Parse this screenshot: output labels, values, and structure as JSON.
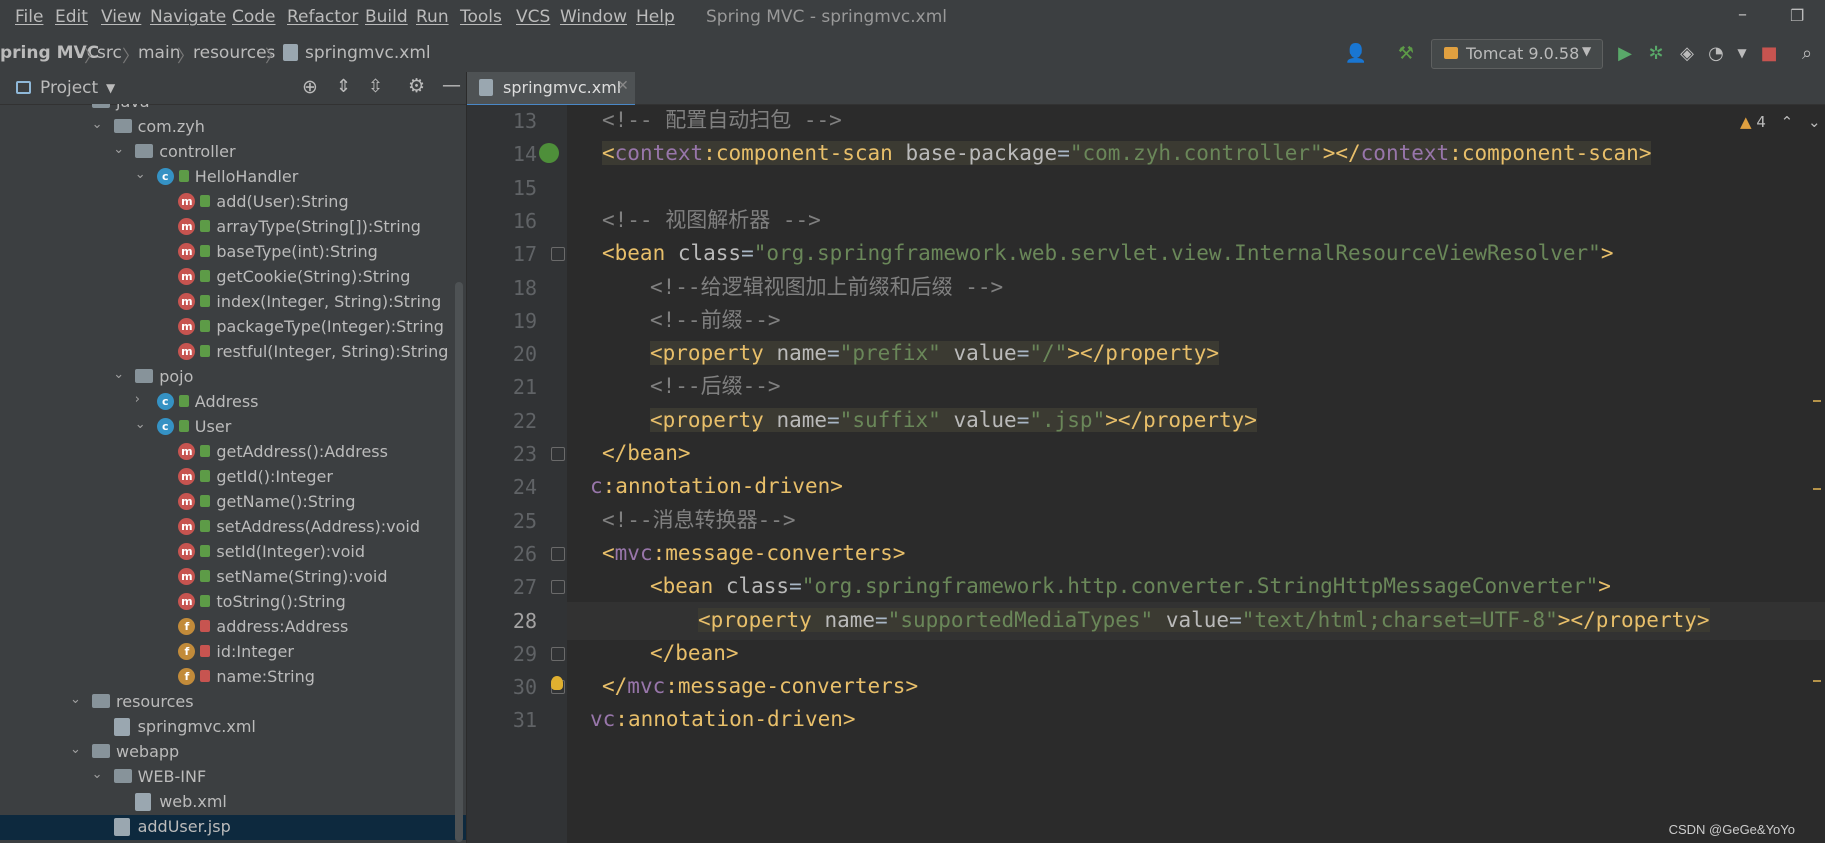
{
  "menu": [
    "File",
    "Edit",
    "View",
    "Navigate",
    "Code",
    "Refactor",
    "Build",
    "Run",
    "Tools",
    "VCS",
    "Window",
    "Help"
  ],
  "window_title": "Spring MVC - springmvc.xml",
  "breadcrumb": [
    "pring MVC",
    "src",
    "main",
    "resources",
    "springmvc.xml"
  ],
  "run_config": "Tomcat 9.0.58",
  "sidebar": {
    "title": "Project",
    "tree": [
      {
        "label": "java",
        "indent": 1,
        "arrow": "",
        "icon": "folder"
      },
      {
        "label": "com.zyh",
        "indent": 2,
        "arrow": "v",
        "icon": "folder"
      },
      {
        "label": "controller",
        "indent": 3,
        "arrow": "v",
        "icon": "folder"
      },
      {
        "label": "HelloHandler",
        "indent": 4,
        "arrow": "v",
        "icon": "c"
      },
      {
        "label": "add(User):String",
        "indent": 5,
        "arrow": "",
        "icon": "m"
      },
      {
        "label": "arrayType(String[]):String",
        "indent": 5,
        "arrow": "",
        "icon": "m"
      },
      {
        "label": "baseType(int):String",
        "indent": 5,
        "arrow": "",
        "icon": "m"
      },
      {
        "label": "getCookie(String):String",
        "indent": 5,
        "arrow": "",
        "icon": "m"
      },
      {
        "label": "index(Integer, String):String",
        "indent": 5,
        "arrow": "",
        "icon": "m"
      },
      {
        "label": "packageType(Integer):String",
        "indent": 5,
        "arrow": "",
        "icon": "m"
      },
      {
        "label": "restful(Integer, String):String",
        "indent": 5,
        "arrow": "",
        "icon": "m"
      },
      {
        "label": "pojo",
        "indent": 3,
        "arrow": "v",
        "icon": "folder"
      },
      {
        "label": "Address",
        "indent": 4,
        "arrow": ">",
        "icon": "c"
      },
      {
        "label": "User",
        "indent": 4,
        "arrow": "v",
        "icon": "c"
      },
      {
        "label": "getAddress():Address",
        "indent": 5,
        "arrow": "",
        "icon": "m"
      },
      {
        "label": "getId():Integer",
        "indent": 5,
        "arrow": "",
        "icon": "m"
      },
      {
        "label": "getName():String",
        "indent": 5,
        "arrow": "",
        "icon": "m"
      },
      {
        "label": "setAddress(Address):void",
        "indent": 5,
        "arrow": "",
        "icon": "m"
      },
      {
        "label": "setId(Integer):void",
        "indent": 5,
        "arrow": "",
        "icon": "m"
      },
      {
        "label": "setName(String):void",
        "indent": 5,
        "arrow": "",
        "icon": "m"
      },
      {
        "label": "toString():String",
        "indent": 5,
        "arrow": "",
        "icon": "m"
      },
      {
        "label": "address:Address",
        "indent": 5,
        "arrow": "",
        "icon": "f"
      },
      {
        "label": "id:Integer",
        "indent": 5,
        "arrow": "",
        "icon": "f"
      },
      {
        "label": "name:String",
        "indent": 5,
        "arrow": "",
        "icon": "f"
      },
      {
        "label": "resources",
        "indent": 1,
        "arrow": "v",
        "icon": "folder"
      },
      {
        "label": "springmvc.xml",
        "indent": 2,
        "arrow": "",
        "icon": "file"
      },
      {
        "label": "webapp",
        "indent": 1,
        "arrow": "v",
        "icon": "folder"
      },
      {
        "label": "WEB-INF",
        "indent": 2,
        "arrow": "v",
        "icon": "folder"
      },
      {
        "label": "web.xml",
        "indent": 3,
        "arrow": "",
        "icon": "file"
      },
      {
        "label": "addUser.jsp",
        "indent": 2,
        "arrow": "",
        "icon": "file",
        "selected": true
      }
    ]
  },
  "editor": {
    "tab": "springmvc.xml",
    "warnings": "4",
    "lines": [
      {
        "n": "13",
        "indent": 1,
        "parts": [
          [
            "com",
            "<!-- 配置自动扫包 -->"
          ]
        ]
      },
      {
        "n": "14",
        "indent": 1,
        "hl": true,
        "parts": [
          [
            "tag",
            "<"
          ],
          [
            "ns",
            "context"
          ],
          [
            "tag",
            ":component-scan "
          ],
          [
            "attr",
            "base-package"
          ],
          [
            "txt",
            "="
          ],
          [
            "val",
            "\"com.zyh.controller\""
          ],
          [
            "tag",
            "></"
          ],
          [
            "ns",
            "context"
          ],
          [
            "tag",
            ":component-scan>"
          ]
        ]
      },
      {
        "n": "15",
        "indent": 0,
        "parts": []
      },
      {
        "n": "16",
        "indent": 1,
        "parts": [
          [
            "com",
            "<!-- 视图解析器 -->"
          ]
        ]
      },
      {
        "n": "17",
        "indent": 1,
        "parts": [
          [
            "tag",
            "<bean "
          ],
          [
            "attr",
            "class"
          ],
          [
            "txt",
            "="
          ],
          [
            "val",
            "\"org.springframework.web.servlet.view.InternalResourceViewResolver\""
          ],
          [
            "tag",
            ">"
          ]
        ]
      },
      {
        "n": "18",
        "indent": 2,
        "parts": [
          [
            "com",
            "<!--给逻辑视图加上前缀和后缀 -->"
          ]
        ]
      },
      {
        "n": "19",
        "indent": 2,
        "parts": [
          [
            "com",
            "<!--前缀-->"
          ]
        ]
      },
      {
        "n": "20",
        "indent": 2,
        "hl": true,
        "parts": [
          [
            "tag",
            "<property "
          ],
          [
            "attr",
            "name"
          ],
          [
            "txt",
            "="
          ],
          [
            "val",
            "\"prefix\""
          ],
          [
            "txt",
            " "
          ],
          [
            "attr",
            "value"
          ],
          [
            "txt",
            "="
          ],
          [
            "val",
            "\"/\""
          ],
          [
            "tag",
            "></property>"
          ]
        ]
      },
      {
        "n": "21",
        "indent": 2,
        "parts": [
          [
            "com",
            "<!--后缀-->"
          ]
        ]
      },
      {
        "n": "22",
        "indent": 2,
        "hl": true,
        "parts": [
          [
            "tag",
            "<property "
          ],
          [
            "attr",
            "name"
          ],
          [
            "txt",
            "="
          ],
          [
            "val",
            "\"suffix\""
          ],
          [
            "txt",
            " "
          ],
          [
            "attr",
            "value"
          ],
          [
            "txt",
            "="
          ],
          [
            "val",
            "\".jsp\""
          ],
          [
            "tag",
            "></property>"
          ]
        ]
      },
      {
        "n": "23",
        "indent": 1,
        "parts": [
          [
            "tag",
            "</bean>"
          ]
        ]
      },
      {
        "n": "24",
        "indent": 0,
        "parts": [
          [
            "ns",
            "c"
          ],
          [
            "tag",
            ":annotation-driven>"
          ]
        ]
      },
      {
        "n": "25",
        "indent": 1,
        "parts": [
          [
            "com",
            "<!--消息转换器-->"
          ]
        ]
      },
      {
        "n": "26",
        "indent": 1,
        "parts": [
          [
            "tag",
            "<"
          ],
          [
            "ns",
            "mvc"
          ],
          [
            "tag",
            ":message-converters>"
          ]
        ]
      },
      {
        "n": "27",
        "indent": 2,
        "parts": [
          [
            "tag",
            "<bean "
          ],
          [
            "attr",
            "class"
          ],
          [
            "txt",
            "="
          ],
          [
            "val",
            "\"org.springframework.http.converter.StringHttpMessageConverter\""
          ],
          [
            "tag",
            ">"
          ]
        ]
      },
      {
        "n": "28",
        "indent": 3,
        "hl": true,
        "cur": true,
        "parts": [
          [
            "tag",
            "<property "
          ],
          [
            "attr",
            "name"
          ],
          [
            "txt",
            "="
          ],
          [
            "val",
            "\"supportedMediaTypes\""
          ],
          [
            "txt",
            " "
          ],
          [
            "attr",
            "value"
          ],
          [
            "txt",
            "="
          ],
          [
            "val",
            "\"text/html;charset=UTF-8\""
          ],
          [
            "tag",
            "></property>"
          ]
        ]
      },
      {
        "n": "29",
        "indent": 2,
        "parts": [
          [
            "tag",
            "</bean>"
          ]
        ]
      },
      {
        "n": "30",
        "indent": 1,
        "parts": [
          [
            "tag",
            "</"
          ],
          [
            "ns",
            "mvc"
          ],
          [
            "tag",
            ":message-converters>"
          ]
        ]
      },
      {
        "n": "31",
        "indent": 0,
        "parts": [
          [
            "ns",
            "vc"
          ],
          [
            "tag",
            ":annotation-driven>"
          ]
        ]
      }
    ]
  },
  "watermark": "CSDN @GeGe&YoYo"
}
